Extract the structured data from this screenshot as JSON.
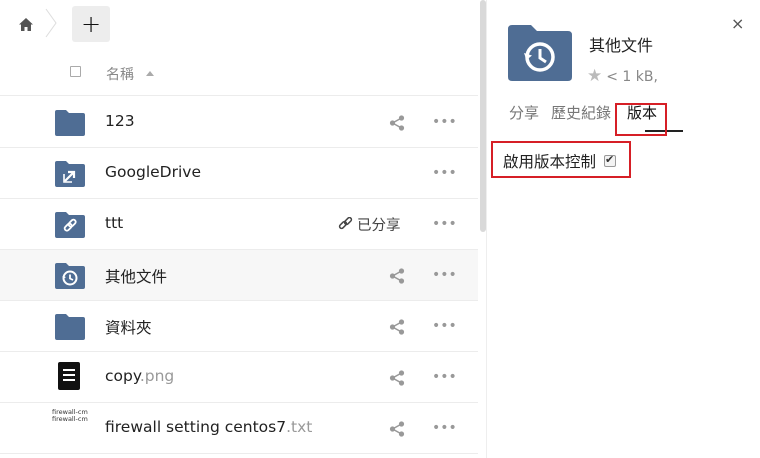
{
  "toolbar": {
    "add_label": "+"
  },
  "list_header": {
    "name_label": "名稱"
  },
  "files": [
    {
      "name": "123",
      "ext": "",
      "icon": "folder-icon",
      "shared": false,
      "active": false
    },
    {
      "name": "GoogleDrive",
      "ext": "",
      "icon": "external-folder-icon",
      "shared": false,
      "active": false
    },
    {
      "name": "ttt",
      "ext": "",
      "icon": "shared-link-folder-icon",
      "shared": true,
      "shared_label": "已分享",
      "active": false
    },
    {
      "name": "其他文件",
      "ext": "",
      "icon": "versions-folder-icon",
      "shared": false,
      "active": true
    },
    {
      "name": "資料夾",
      "ext": "",
      "icon": "folder-icon",
      "shared": false,
      "active": false
    },
    {
      "name": "copy",
      "ext": ".png",
      "icon": "document-thumbnail",
      "shared": false,
      "active": false
    },
    {
      "name": "firewall setting centos7",
      "ext": ".txt",
      "icon": "text-thumbnail",
      "thumb_lines": [
        "firewall-cm",
        "firewall-cm"
      ],
      "shared": false,
      "active": false
    }
  ],
  "more_label": "•••",
  "sidebar": {
    "close_label": "×",
    "title": "其他文件",
    "meta": "< 1 kB,",
    "tabs": [
      {
        "label": "分享"
      },
      {
        "label": "歷史紀錄"
      },
      {
        "label": "版本",
        "active": true
      }
    ],
    "version_control_label": "啟用版本控制"
  },
  "colors": {
    "folder": "#4f6d94",
    "highlight": "#d61f26"
  }
}
